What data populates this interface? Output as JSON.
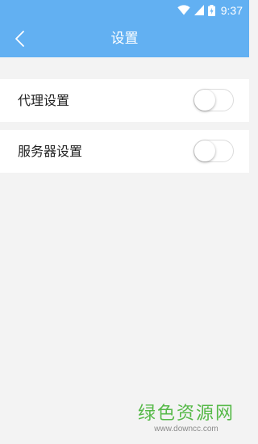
{
  "status_bar": {
    "time": "9:37",
    "icons": [
      "wifi-icon",
      "signal-icon",
      "battery-icon"
    ]
  },
  "app_bar": {
    "title": "设置",
    "back_icon": "chevron-left-icon"
  },
  "settings": [
    {
      "label": "代理设置",
      "enabled": false
    },
    {
      "label": "服务器设置",
      "enabled": false
    }
  ],
  "watermark": {
    "text": "绿色资源网",
    "url": "www.downcc.com"
  },
  "colors": {
    "accent": "#62b0f2",
    "background": "#f3f3f3",
    "watermark": "#56b948"
  }
}
